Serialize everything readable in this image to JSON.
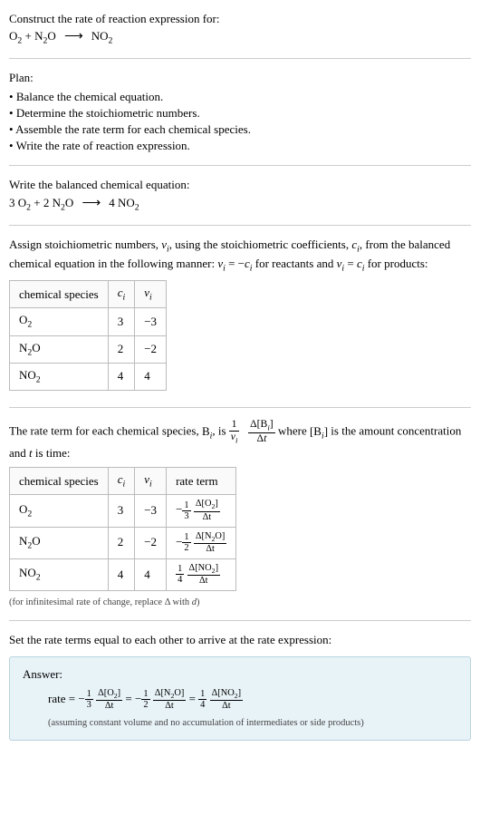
{
  "header": {
    "instruction": "Construct the rate of reaction expression for:"
  },
  "unbalanced": {
    "r1": "O",
    "r1sub": "2",
    "plus1": " + ",
    "r2a": "N",
    "r2asub": "2",
    "r2b": "O",
    "arrow": "⟶",
    "p1": "NO",
    "p1sub": "2"
  },
  "plan": {
    "label": "Plan:",
    "items": [
      "Balance the chemical equation.",
      "Determine the stoichiometric numbers.",
      "Assemble the rate term for each chemical species.",
      "Write the rate of reaction expression."
    ]
  },
  "balance_label": "Write the balanced chemical equation:",
  "balanced": {
    "c1": "3 ",
    "r1": "O",
    "r1sub": "2",
    "plus1": " + ",
    "c2": "2 ",
    "r2a": "N",
    "r2asub": "2",
    "r2b": "O",
    "arrow": "⟶",
    "c3": "4 ",
    "p1": "NO",
    "p1sub": "2"
  },
  "stoich_text": {
    "part1": "Assign stoichiometric numbers, ",
    "nu_i": "ν",
    "nu_i_sub": "i",
    "part2": ", using the stoichiometric coefficients, ",
    "c_i": "c",
    "c_i_sub": "i",
    "part3": ", from the balanced chemical equation in the following manner: ",
    "eq1a": "ν",
    "eq1asub": "i",
    "eq1b": " = −",
    "eq1c": "c",
    "eq1csub": "i",
    "part4": " for reactants and ",
    "eq2a": "ν",
    "eq2asub": "i",
    "eq2b": " = ",
    "eq2c": "c",
    "eq2csub": "i",
    "part5": " for products:"
  },
  "table1": {
    "headers": {
      "species": "chemical species",
      "ci": "c",
      "ci_sub": "i",
      "nui": "ν",
      "nui_sub": "i"
    },
    "rows": [
      {
        "species_a": "O",
        "species_asub": "2",
        "species_b": "",
        "ci": "3",
        "nui": "−3"
      },
      {
        "species_a": "N",
        "species_asub": "2",
        "species_b": "O",
        "ci": "2",
        "nui": "−2"
      },
      {
        "species_a": "NO",
        "species_asub": "2",
        "species_b": "",
        "ci": "4",
        "nui": "4"
      }
    ]
  },
  "rate_term_text": {
    "part1": "The rate term for each chemical species, ",
    "B": "B",
    "B_sub": "i",
    "part2": ", is ",
    "frac1_num": "1",
    "frac1_den_a": "ν",
    "frac1_den_sub": "i",
    "frac2_num_a": "Δ[B",
    "frac2_num_sub": "i",
    "frac2_num_b": "]",
    "frac2_den_a": "Δ",
    "frac2_den_b": "t",
    "part3": " where ",
    "conc_a": "[B",
    "conc_sub": "i",
    "conc_b": "]",
    "part4": " is the amount concentration and ",
    "t": "t",
    "part5": " is time:"
  },
  "table2": {
    "headers": {
      "species": "chemical species",
      "ci": "c",
      "ci_sub": "i",
      "nui": "ν",
      "nui_sub": "i",
      "rate": "rate term"
    },
    "rows": [
      {
        "species_a": "O",
        "species_asub": "2",
        "species_b": "",
        "ci": "3",
        "nui": "−3",
        "sign": "−",
        "coef_num": "1",
        "coef_den": "3",
        "delta_num_a": "Δ[O",
        "delta_num_sub": "2",
        "delta_num_b": "]",
        "delta_den": "Δt"
      },
      {
        "species_a": "N",
        "species_asub": "2",
        "species_b": "O",
        "ci": "2",
        "nui": "−2",
        "sign": "−",
        "coef_num": "1",
        "coef_den": "2",
        "delta_num_a": "Δ[N",
        "delta_num_sub": "2",
        "delta_num_b": "O]",
        "delta_den": "Δt"
      },
      {
        "species_a": "NO",
        "species_asub": "2",
        "species_b": "",
        "ci": "4",
        "nui": "4",
        "sign": "",
        "coef_num": "1",
        "coef_den": "4",
        "delta_num_a": "Δ[NO",
        "delta_num_sub": "2",
        "delta_num_b": "]",
        "delta_den": "Δt"
      }
    ]
  },
  "infinitesimal_note_a": "(for infinitesimal rate of change, replace Δ with ",
  "infinitesimal_note_b": "d",
  "infinitesimal_note_c": ")",
  "set_equal": "Set the rate terms equal to each other to arrive at the rate expression:",
  "answer": {
    "label": "Answer:",
    "rate_label": "rate = ",
    "terms": [
      {
        "sign": "−",
        "coef_num": "1",
        "coef_den": "3",
        "delta_num_a": "Δ[O",
        "delta_num_sub": "2",
        "delta_num_b": "]",
        "delta_den": "Δt"
      },
      {
        "sign": "−",
        "coef_num": "1",
        "coef_den": "2",
        "delta_num_a": "Δ[N",
        "delta_num_sub": "2",
        "delta_num_b": "O]",
        "delta_den": "Δt"
      },
      {
        "sign": "",
        "coef_num": "1",
        "coef_den": "4",
        "delta_num_a": "Δ[NO",
        "delta_num_sub": "2",
        "delta_num_b": "]",
        "delta_den": "Δt"
      }
    ],
    "eq": " = ",
    "assume": "(assuming constant volume and no accumulation of intermediates or side products)"
  },
  "chart_data": {
    "type": "table",
    "title": "Stoichiometric numbers and rate terms",
    "tables": [
      {
        "columns": [
          "chemical species",
          "c_i",
          "ν_i"
        ],
        "rows": [
          [
            "O2",
            3,
            -3
          ],
          [
            "N2O",
            2,
            -2
          ],
          [
            "NO2",
            4,
            4
          ]
        ]
      },
      {
        "columns": [
          "chemical species",
          "c_i",
          "ν_i",
          "rate term"
        ],
        "rows": [
          [
            "O2",
            3,
            -3,
            "-(1/3) Δ[O2]/Δt"
          ],
          [
            "N2O",
            2,
            -2,
            "-(1/2) Δ[N2O]/Δt"
          ],
          [
            "NO2",
            4,
            4,
            "(1/4) Δ[NO2]/Δt"
          ]
        ]
      }
    ],
    "rate_expression": "rate = -(1/3) Δ[O2]/Δt = -(1/2) Δ[N2O]/Δt = (1/4) Δ[NO2]/Δt"
  }
}
